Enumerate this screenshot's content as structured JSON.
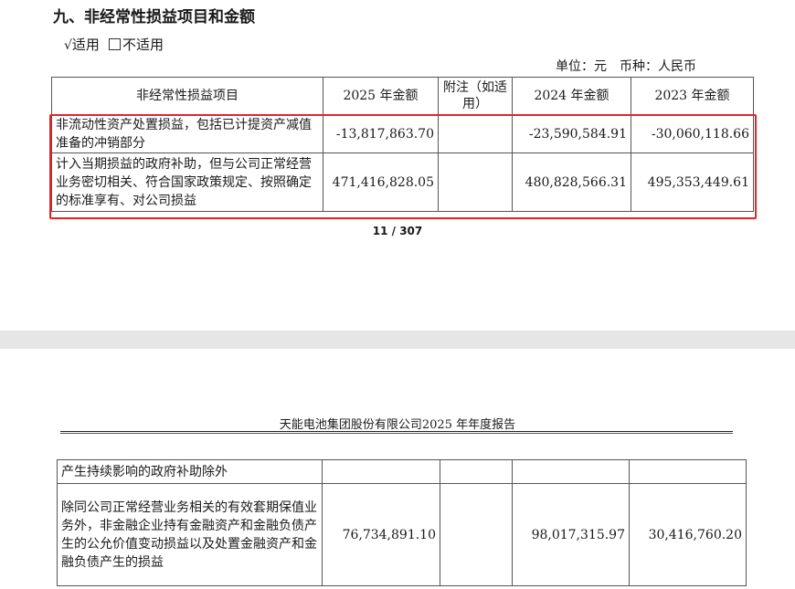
{
  "page1": {
    "section_title": "九、非经常性损益项目和金额",
    "options": {
      "check_mark": "√",
      "applicable": "适用",
      "not_applicable": "不适用"
    },
    "unit": "单位：元　币种：人民币",
    "table": {
      "headers": [
        "非经常性损益项目",
        "2025 年金额",
        "附注（如适用）",
        "2024 年金额",
        "2023 年金额"
      ],
      "rows": [
        {
          "item": "非流动性资产处置损益，包括已计提资产减值准备的冲销部分",
          "y2025": "-13,817,863.70",
          "note": "",
          "y2024": "-23,590,584.91",
          "y2023": "-30,060,118.66"
        },
        {
          "item": "计入当期损益的政府补助，但与公司正常经营业务密切相关、符合国家政策规定、按照确定的标准享有、对公司损益",
          "y2025": "471,416,828.05",
          "note": "",
          "y2024": "480,828,566.31",
          "y2023": "495,353,449.61"
        }
      ]
    },
    "page_number": "11 / 307"
  },
  "page2": {
    "header": "天能电池集团股份有限公司2025 年年度报告",
    "table": {
      "rows": [
        {
          "item": "产生持续影响的政府补助除外",
          "y2025": "",
          "note": "",
          "y2024": "",
          "y2023": ""
        },
        {
          "item": "除同公司正常经营业务相关的有效套期保值业务外，非金融企业持有金融资产和金融负债产生的公允价值变动损益以及处置金融资产和金融负债产生的损益",
          "y2025": "76,734,891.10",
          "note": "",
          "y2024": "98,017,315.97",
          "y2023": "30,416,760.20"
        }
      ]
    }
  },
  "colors": {
    "highlight": "#e0262b",
    "page_gap": "#e6e6e6"
  }
}
